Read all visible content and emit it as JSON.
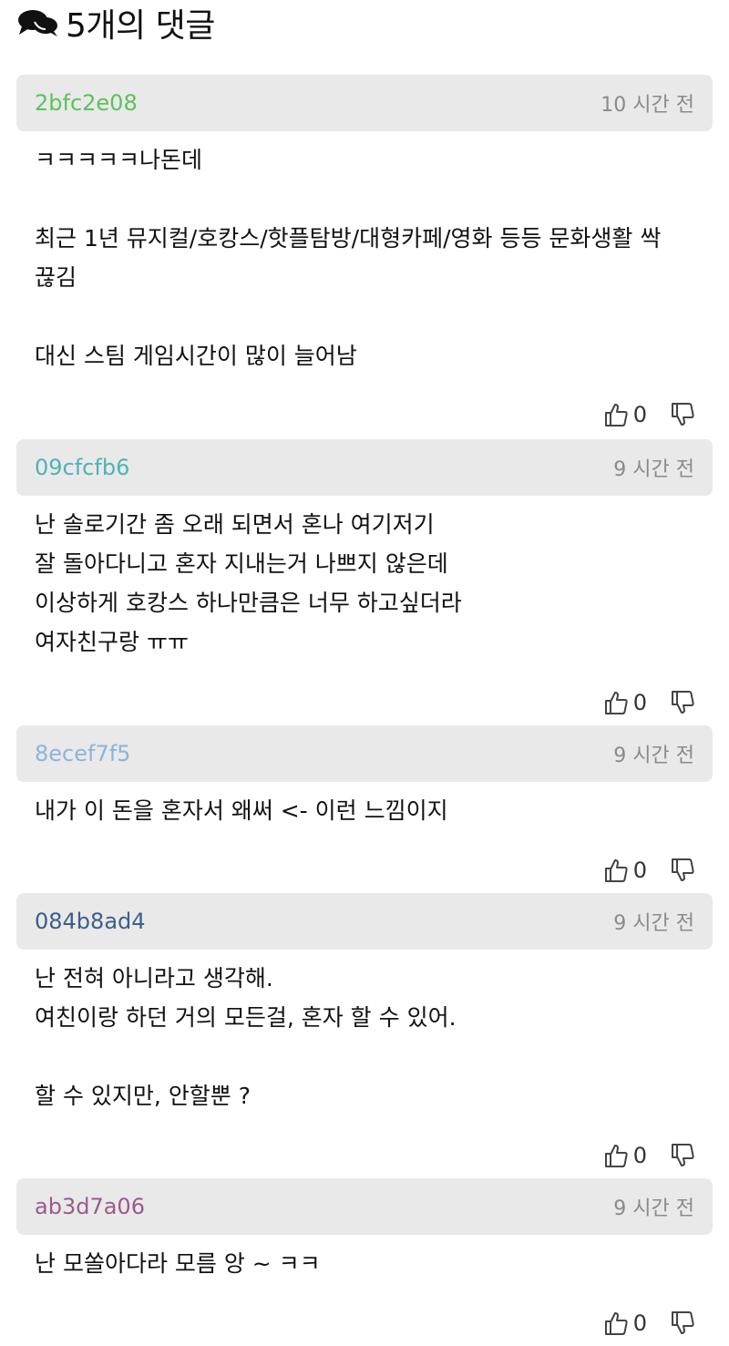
{
  "header": {
    "title": "5개의 댓글",
    "icon": "chat-bubbles-icon"
  },
  "comments": [
    {
      "author": "2bfc2e08",
      "author_color": "#5cc25c",
      "time": "10 시간 전",
      "body": "ㅋㅋㅋㅋㅋ나돈데\n\n최근 1년 뮤지컬/호캉스/핫플탐방/대형카페/영화 등등 문화생활 싹 끊김\n\n대신 스팀 게임시간이 많이 늘어남",
      "likes": "0"
    },
    {
      "author": "09cfcfb6",
      "author_color": "#4fb3b3",
      "time": "9 시간 전",
      "body": "난 솔로기간 좀 오래 되면서 혼나 여기저기\n잘 돌아다니고 혼자 지내는거 나쁘지 않은데\n이상하게 호캉스 하나만큼은 너무 하고싶더라\n여자친구랑 ㅠㅠ",
      "likes": "0"
    },
    {
      "author": "8ecef7f5",
      "author_color": "#8cb4d9",
      "time": "9 시간 전",
      "body": "내가 이 돈을 혼자서 왜써 <- 이런 느낌이지",
      "likes": "0"
    },
    {
      "author": "084b8ad4",
      "author_color": "#3b5f8a",
      "time": "9 시간 전",
      "body": "난 전혀 아니라고 생각해.\n여친이랑 하던 거의 모든걸, 혼자 할 수 있어.\n\n할 수 있지만, 안할뿐 ?",
      "likes": "0"
    },
    {
      "author": "ab3d7a06",
      "author_color": "#9a5b8a",
      "time": "9 시간 전",
      "body": "난 모쏠아다라 모름 앙 ~ ㅋㅋ",
      "likes": "0"
    }
  ]
}
